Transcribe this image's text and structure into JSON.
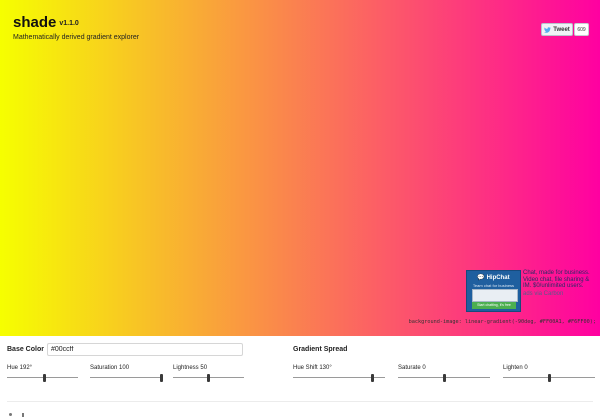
{
  "app": {
    "title": "shade",
    "version": "v1.1.0",
    "subtitle": "Mathematically derived gradient explorer"
  },
  "gradient": {
    "css_text": "background-image: linear-gradient(-90deg, #FF00A1, #F6FF00);",
    "start_color": "#FF00A1",
    "end_color": "#F6FF00"
  },
  "social": {
    "tweet_label": "Tweet",
    "tweet_count": "609"
  },
  "ad": {
    "image_title": "HipChat",
    "image_tagline": "Team chat for business",
    "image_cta": "Start chatting, it's free",
    "text": "Chat, made for business. Video chat, file sharing & IM. $0/unlimited users.",
    "via": "ads via Carbon"
  },
  "base_color": {
    "label": "Base Color",
    "value": "#00ccff",
    "sliders": [
      {
        "label": "Hue 192°",
        "value": 192,
        "max": 360
      },
      {
        "label": "Saturation 100",
        "value": 100,
        "max": 100
      },
      {
        "label": "Lightness 50",
        "value": 50,
        "max": 100
      }
    ]
  },
  "spread": {
    "label": "Gradient Spread",
    "sliders": [
      {
        "label": "Hue Shift 130°",
        "value": 130,
        "min": -180,
        "max": 180
      },
      {
        "label": "Saturate 0",
        "value": 0,
        "min": -100,
        "max": 100
      },
      {
        "label": "Lighten 0",
        "value": 0,
        "min": -100,
        "max": 100
      }
    ]
  }
}
